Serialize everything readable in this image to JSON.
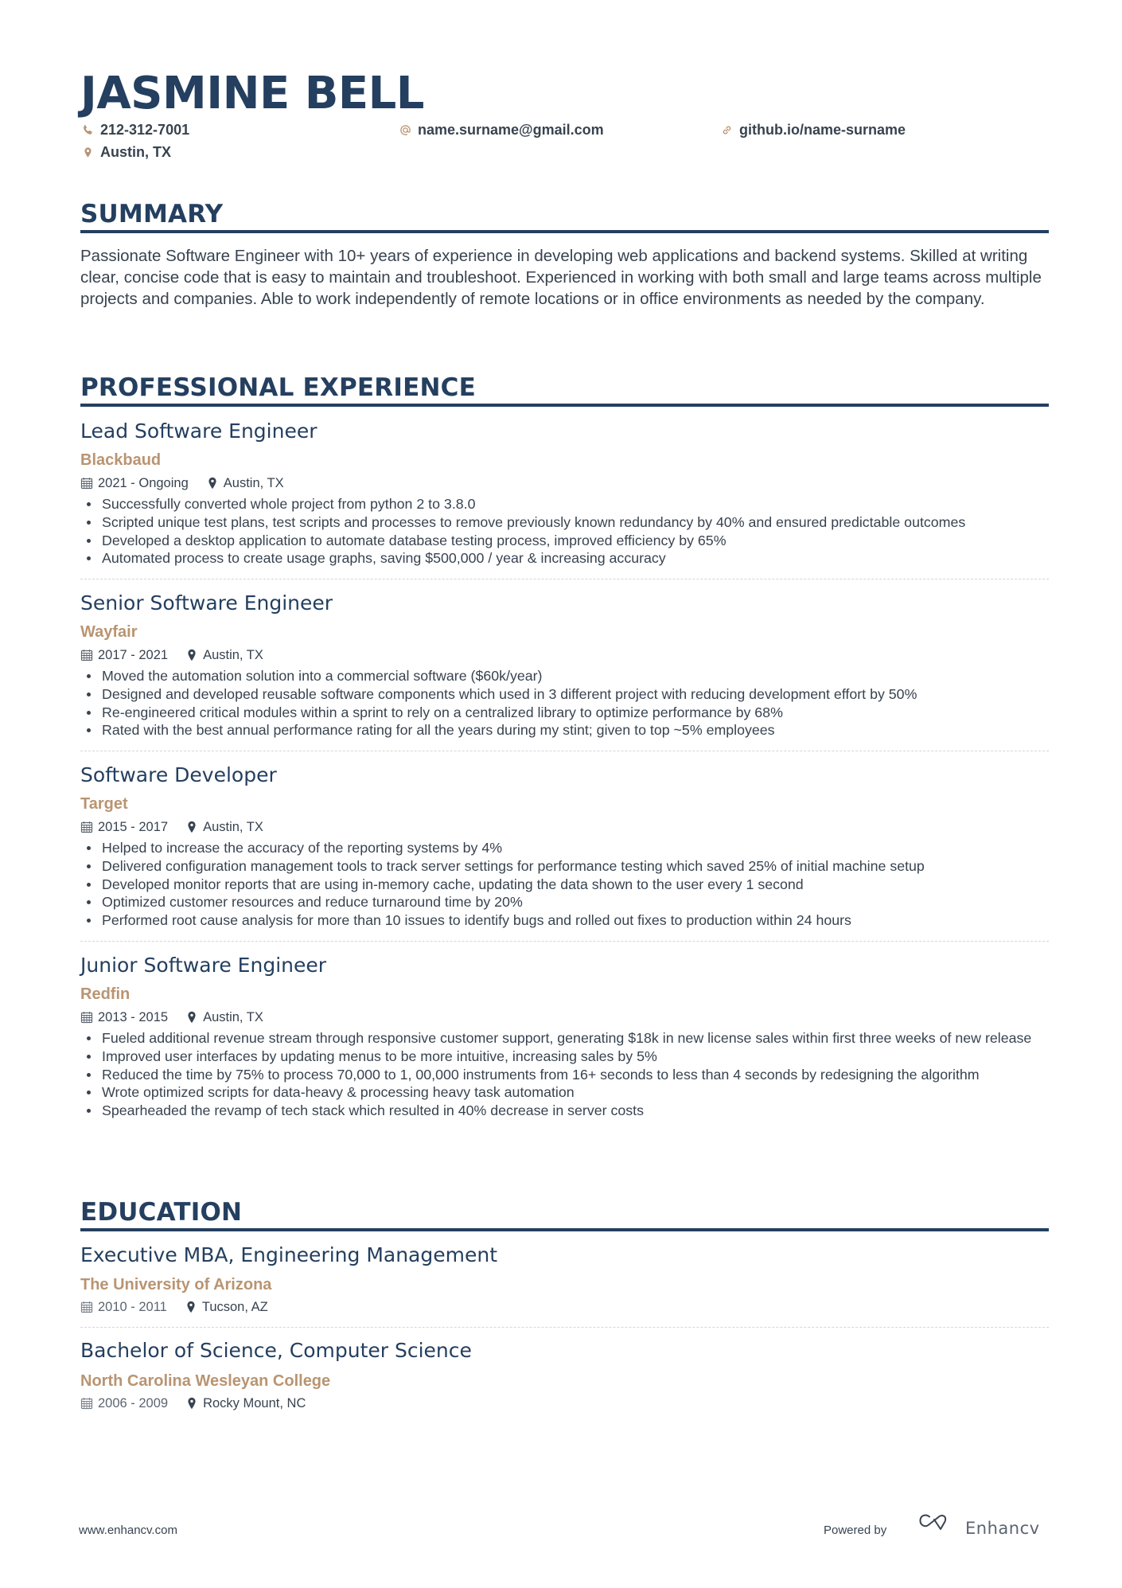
{
  "header": {
    "name": "JASMINE BELL",
    "phone": "212-312-7001",
    "email": "name.surname@gmail.com",
    "link": "github.io/name-surname",
    "location": "Austin, TX"
  },
  "colors": {
    "primary": "#243f5f",
    "accent": "#b99471",
    "text": "#384350"
  },
  "summary": {
    "title": "SUMMARY",
    "text": "Passionate Software Engineer with 10+ years of experience in developing web applications and backend systems. Skilled at writing clear, concise code that is easy to maintain and troubleshoot. Experienced in working with both small and large teams across multiple projects and companies. Able to work independently of remote locations or in office environments as needed by the company."
  },
  "experience": {
    "title": "PROFESSIONAL EXPERIENCE",
    "jobs": [
      {
        "title": "Lead Software Engineer",
        "company": "Blackbaud",
        "dates": "2021 - Ongoing",
        "location": "Austin, TX",
        "bullets": [
          "Successfully converted whole project from python 2 to 3.8.0",
          "Scripted unique test plans, test scripts and processes to remove previously known redundancy by 40% and ensured predictable outcomes",
          "Developed a desktop application to automate database testing process, improved efficiency by 65%",
          "Automated process to create usage graphs, saving $500,000 / year & increasing accuracy"
        ]
      },
      {
        "title": "Senior Software Engineer",
        "company": "Wayfair",
        "dates": "2017 - 2021",
        "location": "Austin, TX",
        "bullets": [
          "Moved the automation solution into a commercial software ($60k/year)",
          "Designed and developed reusable software components which used in 3 different project with reducing development effort by 50%",
          "Re-engineered critical modules within a sprint to rely on a centralized library to optimize performance by 68%",
          "Rated with the best annual performance rating for all the years during my stint; given to top ~5% employees"
        ]
      },
      {
        "title": "Software Developer",
        "company": "Target",
        "dates": "2015 - 2017",
        "location": "Austin, TX",
        "bullets": [
          "Helped to increase the accuracy of the reporting systems by 4%",
          "Delivered configuration management tools to track server settings for performance testing which saved 25% of initial machine setup",
          "Developed monitor reports that are using in-memory cache, updating the data shown to the user every 1 second",
          "Optimized customer resources and reduce turnaround time by 20%",
          "Performed root cause analysis for more than 10 issues to identify bugs and rolled out fixes to production within 24 hours"
        ]
      },
      {
        "title": "Junior Software Engineer",
        "company": "Redfin",
        "dates": "2013 - 2015",
        "location": "Austin, TX",
        "bullets": [
          "Fueled additional revenue stream through responsive customer support, generating $18k in new license sales within first three weeks of new release",
          "Improved user interfaces by updating menus to be more intuitive, increasing sales by 5%",
          "Reduced the time by 75% to process 70,000 to 1, 00,000 instruments from 16+ seconds to less than 4 seconds by redesigning the algorithm",
          "Wrote optimized scripts for data-heavy & processing heavy task automation",
          "Spearheaded the revamp of tech stack which resulted in 40% decrease in server costs"
        ]
      }
    ]
  },
  "education": {
    "title": "EDUCATION",
    "items": [
      {
        "degree": "Executive MBA, Engineering Management",
        "school": "The University of Arizona",
        "dates": "2010 - 2011",
        "location": "Tucson, AZ"
      },
      {
        "degree": "Bachelor of Science, Computer Science",
        "school": "North Carolina Wesleyan College",
        "dates": "2006 - 2009",
        "location": "Rocky Mount, NC"
      }
    ]
  },
  "footer": {
    "url": "www.enhancv.com",
    "powered_by": "Powered by",
    "brand": "Enhancv"
  }
}
